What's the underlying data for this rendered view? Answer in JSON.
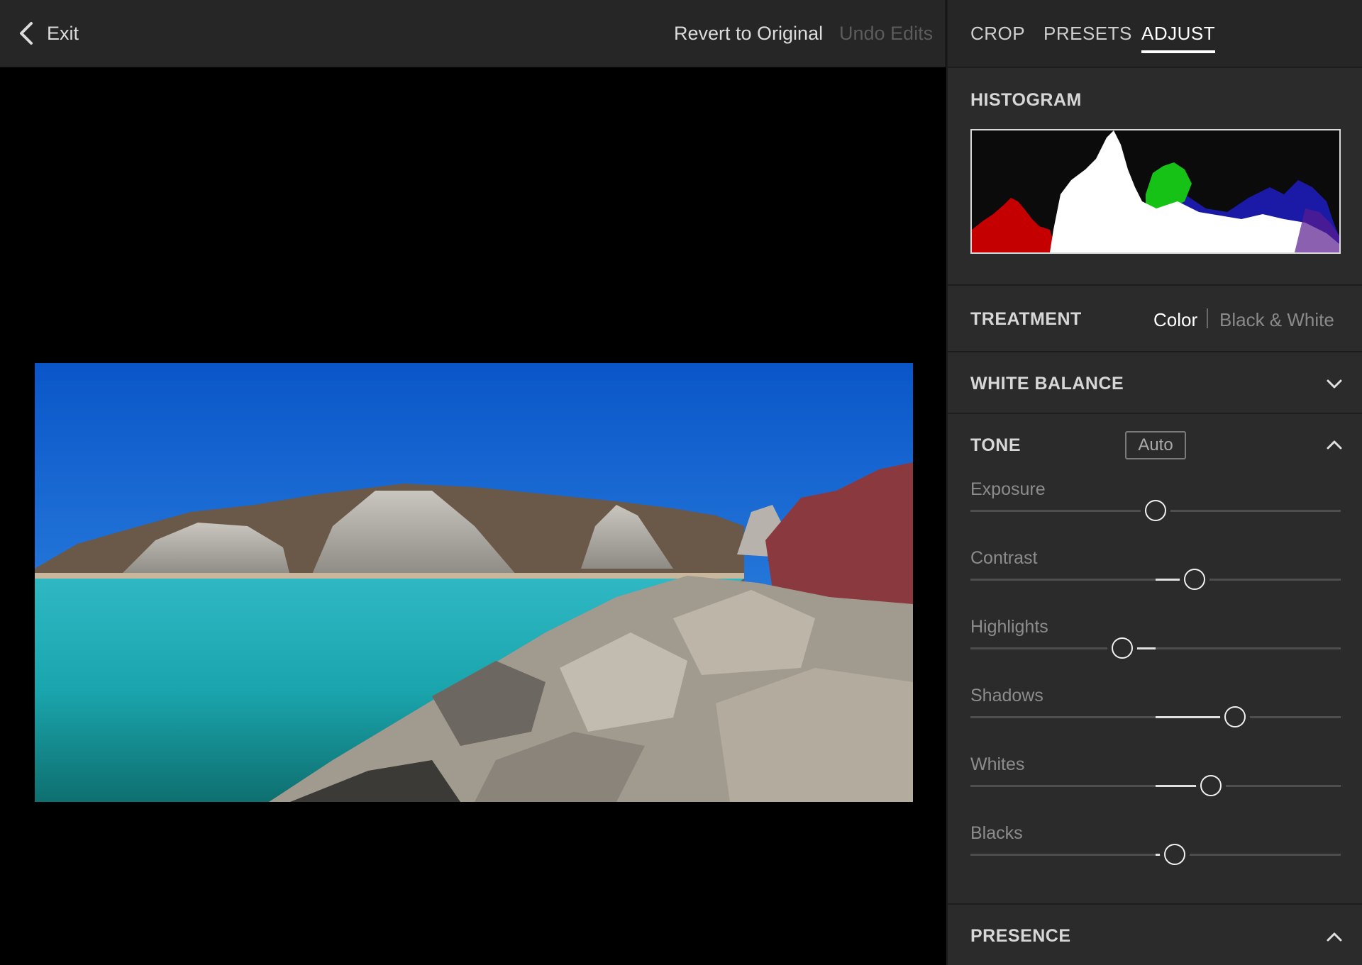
{
  "topbar": {
    "exit_label": "Exit",
    "revert_label": "Revert to Original",
    "undo_label": "Undo Edits"
  },
  "tabs": [
    {
      "label": "CROP",
      "active": false
    },
    {
      "label": "PRESETS",
      "active": false
    },
    {
      "label": "ADJUST",
      "active": true
    }
  ],
  "histogram": {
    "title": "HISTOGRAM"
  },
  "treatment": {
    "title": "TREATMENT",
    "options": [
      "Color",
      "Black & White"
    ],
    "selected": "Color"
  },
  "white_balance": {
    "title": "WHITE BALANCE",
    "expanded": false
  },
  "tone": {
    "title": "TONE",
    "auto_label": "Auto",
    "expanded": true,
    "sliders": [
      {
        "label": "Exposure",
        "value": 0.5
      },
      {
        "label": "Contrast",
        "value": 0.605
      },
      {
        "label": "Highlights",
        "value": 0.41
      },
      {
        "label": "Shadows",
        "value": 0.715
      },
      {
        "label": "Whites",
        "value": 0.65
      },
      {
        "label": "Blacks",
        "value": 0.552
      }
    ]
  },
  "presence": {
    "title": "PRESENCE",
    "expanded": true
  },
  "colors": {
    "panel_bg": "#2b2b2b",
    "topbar_bg": "#262626",
    "active_tab": "#ffffff",
    "disabled_text": "#5c5c5c"
  },
  "icons": {
    "back": "chevron-left-icon",
    "collapse": "chevron-up-icon",
    "expand": "chevron-down-icon"
  }
}
